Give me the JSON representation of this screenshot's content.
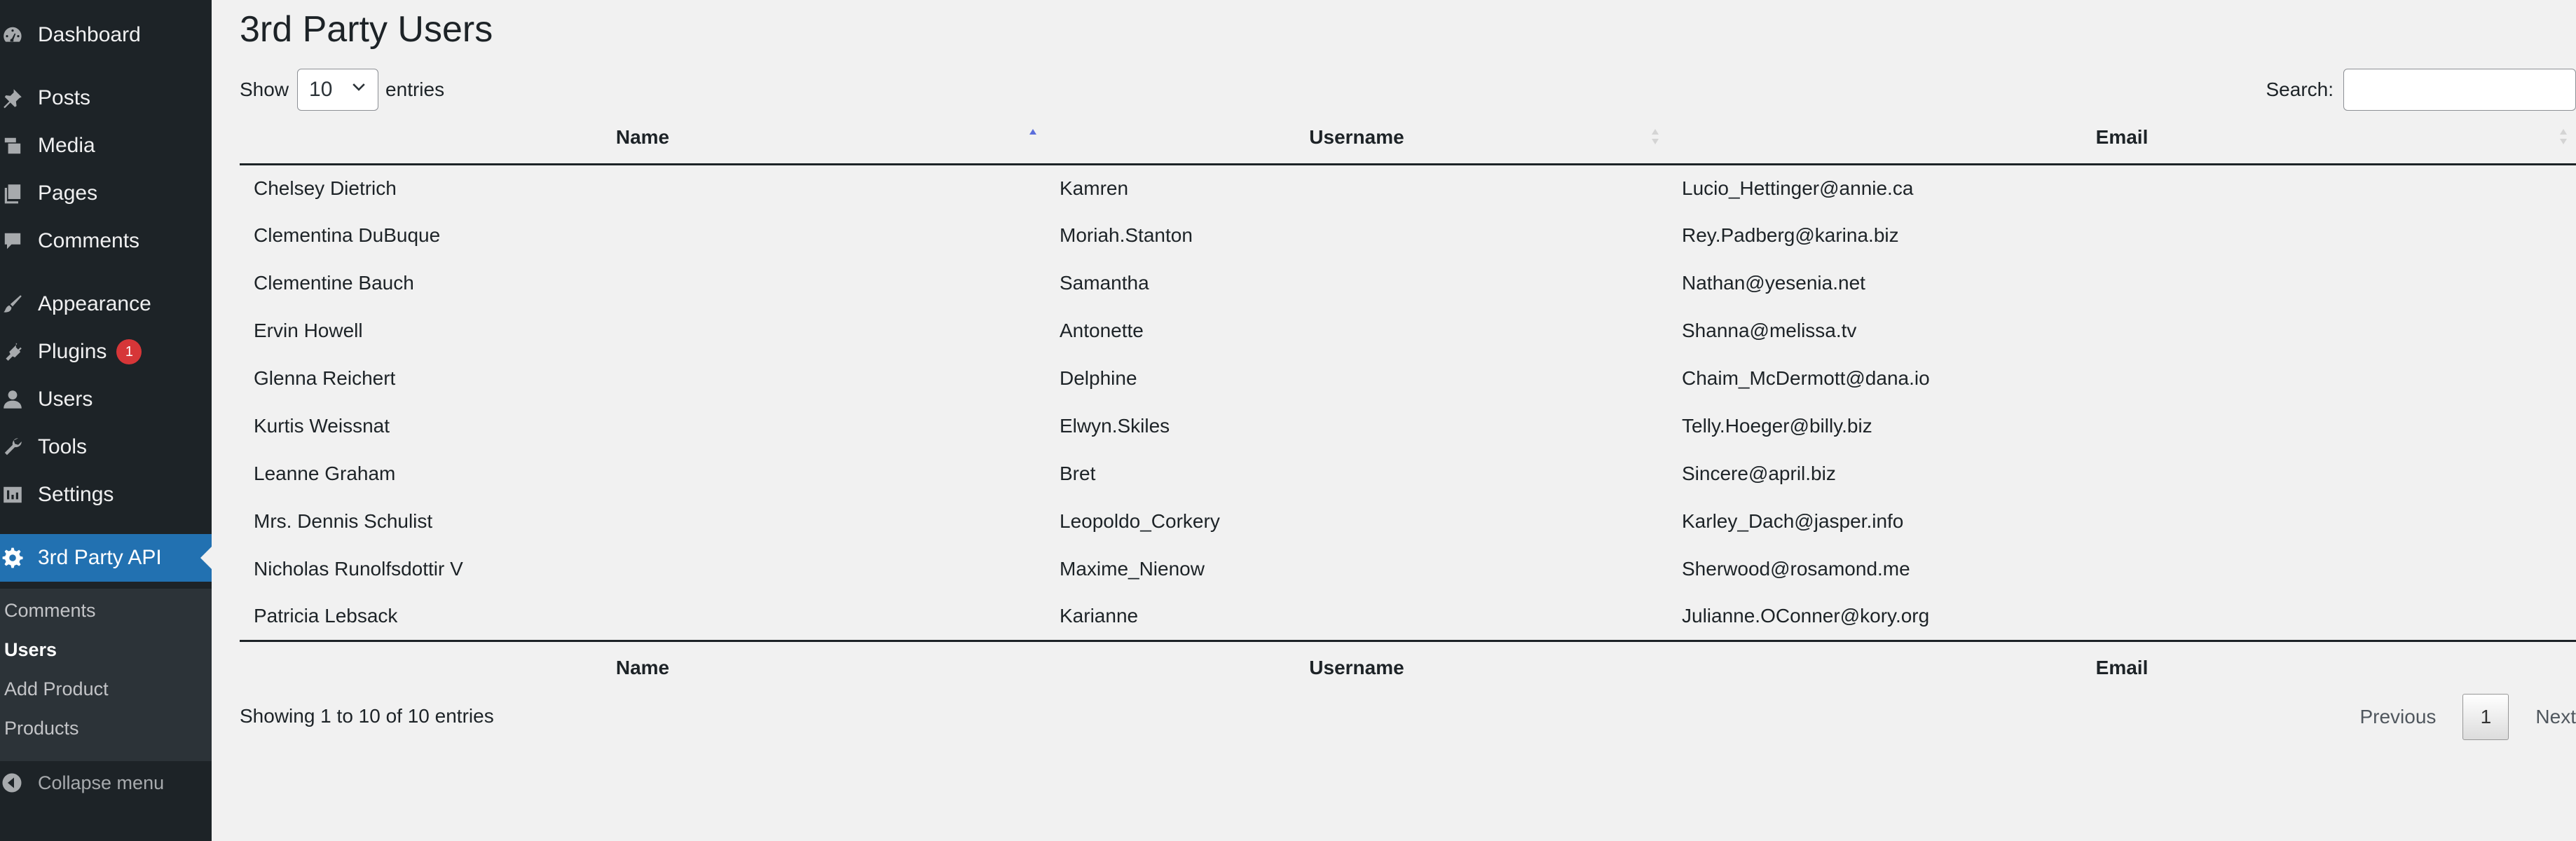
{
  "sidebar": {
    "menu": [
      {
        "label": "Dashboard",
        "icon": "dashboard-icon"
      },
      {
        "label": "Posts",
        "icon": "pin-icon"
      },
      {
        "label": "Media",
        "icon": "media-icon"
      },
      {
        "label": "Pages",
        "icon": "pages-icon"
      },
      {
        "label": "Comments",
        "icon": "comment-icon"
      },
      {
        "label": "Appearance",
        "icon": "brush-icon"
      },
      {
        "label": "Plugins",
        "icon": "plug-icon",
        "badge": "1"
      },
      {
        "label": "Users",
        "icon": "user-icon"
      },
      {
        "label": "Tools",
        "icon": "wrench-icon"
      },
      {
        "label": "Settings",
        "icon": "settings-icon"
      },
      {
        "label": "3rd Party API",
        "icon": "gear-icon",
        "active": true
      }
    ],
    "submenu": [
      {
        "label": "Comments"
      },
      {
        "label": "Users",
        "current": true
      },
      {
        "label": "Add Product"
      },
      {
        "label": "Products"
      }
    ],
    "collapse_label": "Collapse menu",
    "colors": {
      "background": "#1d2327",
      "submenu": "#2c3338",
      "active": "#2271b1",
      "badge": "#d63638"
    }
  },
  "page": {
    "title": "3rd Party Users",
    "length_prefix": "Show",
    "length_value": "10",
    "length_suffix": "entries",
    "search_label": "Search:",
    "search_value": ""
  },
  "table": {
    "columns": [
      "Name",
      "Username",
      "Email"
    ],
    "sorted_column": "Name",
    "sort_direction": "ascending",
    "rows": [
      [
        "Chelsey Dietrich",
        "Kamren",
        "Lucio_Hettinger@annie.ca"
      ],
      [
        "Clementina DuBuque",
        "Moriah.Stanton",
        "Rey.Padberg@karina.biz"
      ],
      [
        "Clementine Bauch",
        "Samantha",
        "Nathan@yesenia.net"
      ],
      [
        "Ervin Howell",
        "Antonette",
        "Shanna@melissa.tv"
      ],
      [
        "Glenna Reichert",
        "Delphine",
        "Chaim_McDermott@dana.io"
      ],
      [
        "Kurtis Weissnat",
        "Elwyn.Skiles",
        "Telly.Hoeger@billy.biz"
      ],
      [
        "Leanne Graham",
        "Bret",
        "Sincere@april.biz"
      ],
      [
        "Mrs. Dennis Schulist",
        "Leopoldo_Corkery",
        "Karley_Dach@jasper.info"
      ],
      [
        "Nicholas Runolfsdottir V",
        "Maxime_Nienow",
        "Sherwood@rosamond.me"
      ],
      [
        "Patricia Lebsack",
        "Karianne",
        "Julianne.OConner@kory.org"
      ]
    ]
  },
  "footer": {
    "info": "Showing 1 to 10 of 10 entries",
    "previous": "Previous",
    "current_page": "1",
    "next": "Next"
  }
}
